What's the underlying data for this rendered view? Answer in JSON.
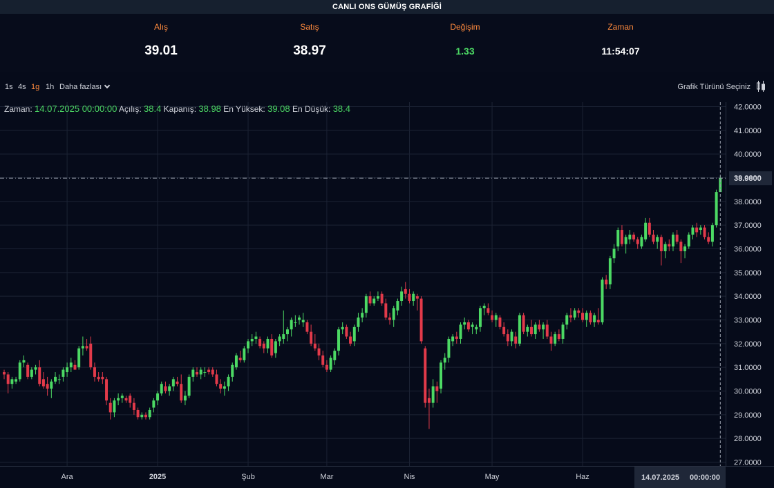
{
  "title": "CANLI ONS GÜMÜŞ GRAFİĞİ",
  "stats": {
    "alis_label": "Alış",
    "alis_value": "39.01",
    "satis_label": "Satış",
    "satis_value": "38.97",
    "degisim_label": "Değişim",
    "degisim_value": "1.33",
    "zaman_label": "Zaman",
    "zaman_value": "11:54:07"
  },
  "toolbar": {
    "timeframes": [
      "1s",
      "4s",
      "1g",
      "1h"
    ],
    "active_timeframe": "1g",
    "more_label": "Daha fazlası",
    "chart_type_label": "Grafik Türünü Seçiniz"
  },
  "ohlc": {
    "time_label": "Zaman:",
    "time_value": "14.07.2025 00:00:00",
    "open_label": "Açılış:",
    "open_value": "38.4",
    "close_label": "Kapanış:",
    "close_value": "38.98",
    "high_label": "En Yüksek:",
    "high_value": "39.08",
    "low_label": "En Düşük:",
    "low_value": "38.4"
  },
  "crosshair": {
    "date_label": "14.07.2025",
    "time_label": "00:00:00",
    "price_label": "38.9800"
  },
  "colors": {
    "up": "#4cd964",
    "down": "#e23a4a",
    "accent": "#ff8a3d",
    "background": "#060b1a",
    "grid": "#1c2334"
  },
  "chart_data": {
    "type": "candlestick",
    "ylim": [
      27,
      42
    ],
    "y_ticks": [
      "42.0000",
      "41.0000",
      "40.0000",
      "39.0000",
      "38.0000",
      "37.0000",
      "36.0000",
      "35.0000",
      "34.0000",
      "33.0000",
      "32.0000",
      "31.0000",
      "30.0000",
      "29.0000",
      "28.0000",
      "27.0000"
    ],
    "x_ticks": [
      {
        "label": "Ara",
        "index": 16,
        "bold": false
      },
      {
        "label": "2025",
        "index": 39,
        "bold": true
      },
      {
        "label": "Şub",
        "index": 62,
        "bold": false
      },
      {
        "label": "Mar",
        "index": 82,
        "bold": false
      },
      {
        "label": "Nis",
        "index": 103,
        "bold": false
      },
      {
        "label": "May",
        "index": 124,
        "bold": false
      },
      {
        "label": "Haz",
        "index": 147,
        "bold": false
      }
    ],
    "candles": [
      [
        30.8,
        30.9,
        30.5,
        30.7
      ],
      [
        30.7,
        30.8,
        29.9,
        30.3
      ],
      [
        30.3,
        30.6,
        30.1,
        30.5
      ],
      [
        30.4,
        30.6,
        30.3,
        30.5
      ],
      [
        30.5,
        31.3,
        30.4,
        31.2
      ],
      [
        31.2,
        31.5,
        31.0,
        31.3
      ],
      [
        31.1,
        31.2,
        30.5,
        30.6
      ],
      [
        30.6,
        31.0,
        30.5,
        30.9
      ],
      [
        30.9,
        31.1,
        30.7,
        31.0
      ],
      [
        31.0,
        31.3,
        30.2,
        30.3
      ],
      [
        30.5,
        30.8,
        30.1,
        30.2
      ],
      [
        30.3,
        30.6,
        29.8,
        30.1
      ],
      [
        30.1,
        30.5,
        29.7,
        30.4
      ],
      [
        30.4,
        30.8,
        30.3,
        30.6
      ],
      [
        30.5,
        30.7,
        30.3,
        30.5
      ],
      [
        30.6,
        31.0,
        30.4,
        30.9
      ],
      [
        30.8,
        31.2,
        30.6,
        31.0
      ],
      [
        31.0,
        31.4,
        30.8,
        31.2
      ],
      [
        31.1,
        31.3,
        30.9,
        30.9
      ],
      [
        31.0,
        31.9,
        30.9,
        31.8
      ],
      [
        31.8,
        32.3,
        31.5,
        31.9
      ],
      [
        31.9,
        32.2,
        31.7,
        31.8
      ],
      [
        32.0,
        32.3,
        30.9,
        31.0
      ],
      [
        31.0,
        31.2,
        30.4,
        30.6
      ],
      [
        30.6,
        30.8,
        30.4,
        30.5
      ],
      [
        30.6,
        30.8,
        30.3,
        30.5
      ],
      [
        30.5,
        30.6,
        29.4,
        29.6
      ],
      [
        29.5,
        29.7,
        28.8,
        29.1
      ],
      [
        29.1,
        29.7,
        28.9,
        29.6
      ],
      [
        29.6,
        29.9,
        29.4,
        29.7
      ],
      [
        29.7,
        29.9,
        29.5,
        29.8
      ],
      [
        29.7,
        29.8,
        29.5,
        29.6
      ],
      [
        29.8,
        29.9,
        29.3,
        29.5
      ],
      [
        29.5,
        29.7,
        29.0,
        29.2
      ],
      [
        29.2,
        29.3,
        28.8,
        28.9
      ],
      [
        28.9,
        29.1,
        28.8,
        29.0
      ],
      [
        29.0,
        29.1,
        28.8,
        28.9
      ],
      [
        28.9,
        29.3,
        28.8,
        29.2
      ],
      [
        29.3,
        29.7,
        29.1,
        29.6
      ],
      [
        29.6,
        30.0,
        29.4,
        29.9
      ],
      [
        29.9,
        30.4,
        29.8,
        30.3
      ],
      [
        30.2,
        30.4,
        29.9,
        30.0
      ],
      [
        30.0,
        30.3,
        29.8,
        30.2
      ],
      [
        30.2,
        30.6,
        30.0,
        30.5
      ],
      [
        30.4,
        30.6,
        30.2,
        30.3
      ],
      [
        30.3,
        30.7,
        29.5,
        29.6
      ],
      [
        29.6,
        30.0,
        29.4,
        29.8
      ],
      [
        29.8,
        30.7,
        29.7,
        30.6
      ],
      [
        30.6,
        31.0,
        30.4,
        30.9
      ],
      [
        30.8,
        31.0,
        30.6,
        30.7
      ],
      [
        30.7,
        31.0,
        30.5,
        30.9
      ],
      [
        30.8,
        31.0,
        30.6,
        30.8
      ],
      [
        30.9,
        31.0,
        30.7,
        30.8
      ],
      [
        30.9,
        31.0,
        30.6,
        30.7
      ],
      [
        30.7,
        30.9,
        30.2,
        30.3
      ],
      [
        30.3,
        30.5,
        29.9,
        30.1
      ],
      [
        30.1,
        30.4,
        29.8,
        30.2
      ],
      [
        30.2,
        30.7,
        30.0,
        30.6
      ],
      [
        30.6,
        31.2,
        30.4,
        31.1
      ],
      [
        31.0,
        31.6,
        30.9,
        31.5
      ],
      [
        31.4,
        31.7,
        31.2,
        31.3
      ],
      [
        31.3,
        31.9,
        31.2,
        31.8
      ],
      [
        31.8,
        32.2,
        31.6,
        32.1
      ],
      [
        32.1,
        32.4,
        31.9,
        32.2
      ],
      [
        32.2,
        32.5,
        32.0,
        32.3
      ],
      [
        32.2,
        32.3,
        31.8,
        31.9
      ],
      [
        32.0,
        32.1,
        31.6,
        31.8
      ],
      [
        31.8,
        32.3,
        31.6,
        32.2
      ],
      [
        32.2,
        32.4,
        31.4,
        31.5
      ],
      [
        31.6,
        32.2,
        31.4,
        32.1
      ],
      [
        32.1,
        32.4,
        31.9,
        32.3
      ],
      [
        32.2,
        33.4,
        32.0,
        32.4
      ],
      [
        32.4,
        32.7,
        32.1,
        32.6
      ],
      [
        32.6,
        33.1,
        32.3,
        33.0
      ],
      [
        32.9,
        33.2,
        32.7,
        32.9
      ],
      [
        33.0,
        33.2,
        32.8,
        33.1
      ],
      [
        32.9,
        33.3,
        32.7,
        33.0
      ],
      [
        32.9,
        33.0,
        32.4,
        32.5
      ],
      [
        32.5,
        32.8,
        31.9,
        32.0
      ],
      [
        32.0,
        32.4,
        31.7,
        31.8
      ],
      [
        31.8,
        32.0,
        31.3,
        31.5
      ],
      [
        31.5,
        31.7,
        31.0,
        31.1
      ],
      [
        31.1,
        31.3,
        30.8,
        30.9
      ],
      [
        30.9,
        31.5,
        30.8,
        31.4
      ],
      [
        31.3,
        31.8,
        31.1,
        31.7
      ],
      [
        31.7,
        32.7,
        31.5,
        32.6
      ],
      [
        32.6,
        32.9,
        32.4,
        32.7
      ],
      [
        32.7,
        32.8,
        32.2,
        32.3
      ],
      [
        32.3,
        32.5,
        31.9,
        32.0
      ],
      [
        32.1,
        32.8,
        31.9,
        32.7
      ],
      [
        32.7,
        33.3,
        32.5,
        33.1
      ],
      [
        33.1,
        33.5,
        32.9,
        33.3
      ],
      [
        33.3,
        34.1,
        33.1,
        34.0
      ],
      [
        34.0,
        34.2,
        33.6,
        33.7
      ],
      [
        33.7,
        34.0,
        33.6,
        33.9
      ],
      [
        33.9,
        34.2,
        33.8,
        34.0
      ],
      [
        34.1,
        34.2,
        33.6,
        33.7
      ],
      [
        33.7,
        33.9,
        33.0,
        33.1
      ],
      [
        33.1,
        33.3,
        32.8,
        33.0
      ],
      [
        33.0,
        33.6,
        32.7,
        33.5
      ],
      [
        33.4,
        33.9,
        33.2,
        33.8
      ],
      [
        33.8,
        34.4,
        33.6,
        34.2
      ],
      [
        34.3,
        34.6,
        33.9,
        34.1
      ],
      [
        34.1,
        34.3,
        33.7,
        33.8
      ],
      [
        33.8,
        34.2,
        33.6,
        34.1
      ],
      [
        34.0,
        34.1,
        33.4,
        33.9
      ],
      [
        33.9,
        34.0,
        32.0,
        32.1
      ],
      [
        31.8,
        31.9,
        29.3,
        29.5
      ],
      [
        29.7,
        30.1,
        28.4,
        29.5
      ],
      [
        29.5,
        30.5,
        29.3,
        30.2
      ],
      [
        30.2,
        30.4,
        29.5,
        30.0
      ],
      [
        30.1,
        31.3,
        29.9,
        31.2
      ],
      [
        31.2,
        31.6,
        30.9,
        31.4
      ],
      [
        31.4,
        32.3,
        31.2,
        32.2
      ],
      [
        32.1,
        32.4,
        31.9,
        32.3
      ],
      [
        32.3,
        32.5,
        32.0,
        32.2
      ],
      [
        32.2,
        32.9,
        32.0,
        32.8
      ],
      [
        32.8,
        33.1,
        32.6,
        32.9
      ],
      [
        32.9,
        33.0,
        32.5,
        32.6
      ],
      [
        32.7,
        32.9,
        32.4,
        32.8
      ],
      [
        32.6,
        32.8,
        32.4,
        32.7
      ],
      [
        32.7,
        33.6,
        32.5,
        33.5
      ],
      [
        33.5,
        33.7,
        33.2,
        33.6
      ],
      [
        33.5,
        33.7,
        33.2,
        33.3
      ],
      [
        33.2,
        33.4,
        32.9,
        33.0
      ],
      [
        33.0,
        33.3,
        32.7,
        33.2
      ],
      [
        33.1,
        33.2,
        32.6,
        32.7
      ],
      [
        32.7,
        32.9,
        32.3,
        32.4
      ],
      [
        32.4,
        32.6,
        31.9,
        32.1
      ],
      [
        32.1,
        32.6,
        31.9,
        32.5
      ],
      [
        32.3,
        32.5,
        31.8,
        32.0
      ],
      [
        32.0,
        33.3,
        31.9,
        33.2
      ],
      [
        33.2,
        33.3,
        32.4,
        32.5
      ],
      [
        32.5,
        32.8,
        32.3,
        32.7
      ],
      [
        32.7,
        33.0,
        32.3,
        32.4
      ],
      [
        32.4,
        32.9,
        32.2,
        32.8
      ],
      [
        32.8,
        33.0,
        32.5,
        32.6
      ],
      [
        32.6,
        32.9,
        32.2,
        32.8
      ],
      [
        32.8,
        33.0,
        32.2,
        32.3
      ],
      [
        32.3,
        32.5,
        31.7,
        32.0
      ],
      [
        32.0,
        32.5,
        31.9,
        32.4
      ],
      [
        32.4,
        32.6,
        32.1,
        32.2
      ],
      [
        32.2,
        32.9,
        32.0,
        32.8
      ],
      [
        32.8,
        33.3,
        32.6,
        33.2
      ],
      [
        33.2,
        33.5,
        32.9,
        33.1
      ],
      [
        33.1,
        33.5,
        33.0,
        33.4
      ],
      [
        33.4,
        33.5,
        33.1,
        33.3
      ],
      [
        33.3,
        33.5,
        32.9,
        33.0
      ],
      [
        33.0,
        33.4,
        32.7,
        33.3
      ],
      [
        33.3,
        33.4,
        32.8,
        32.9
      ],
      [
        32.9,
        33.3,
        32.7,
        33.2
      ],
      [
        33.0,
        33.5,
        32.8,
        32.9
      ],
      [
        32.9,
        34.8,
        32.8,
        34.7
      ],
      [
        34.7,
        34.9,
        34.3,
        34.5
      ],
      [
        34.5,
        35.7,
        34.3,
        35.6
      ],
      [
        35.6,
        36.2,
        35.4,
        36.0
      ],
      [
        36.1,
        36.9,
        35.9,
        36.8
      ],
      [
        36.8,
        37.0,
        36.1,
        36.2
      ],
      [
        36.2,
        36.6,
        35.8,
        36.5
      ],
      [
        36.4,
        36.8,
        36.2,
        36.6
      ],
      [
        36.6,
        36.7,
        36.3,
        36.4
      ],
      [
        36.4,
        36.5,
        36.0,
        36.2
      ],
      [
        36.1,
        36.6,
        36.0,
        36.5
      ],
      [
        36.4,
        37.3,
        36.3,
        37.1
      ],
      [
        37.1,
        37.3,
        36.5,
        36.6
      ],
      [
        36.6,
        36.8,
        36.2,
        36.3
      ],
      [
        36.3,
        36.6,
        36.0,
        36.5
      ],
      [
        36.5,
        36.6,
        35.3,
        35.9
      ],
      [
        35.9,
        36.3,
        35.6,
        36.2
      ],
      [
        36.2,
        36.4,
        35.9,
        36.1
      ],
      [
        36.1,
        36.7,
        35.9,
        36.6
      ],
      [
        36.6,
        36.8,
        36.2,
        36.3
      ],
      [
        36.3,
        36.4,
        35.4,
        35.9
      ],
      [
        35.9,
        36.2,
        35.6,
        36.1
      ],
      [
        36.1,
        36.7,
        36.0,
        36.6
      ],
      [
        36.6,
        37.0,
        36.4,
        36.9
      ],
      [
        36.9,
        37.1,
        36.5,
        36.7
      ],
      [
        36.8,
        37.0,
        36.6,
        36.9
      ],
      [
        36.9,
        37.0,
        36.4,
        36.5
      ],
      [
        36.5,
        36.7,
        36.2,
        36.3
      ],
      [
        36.3,
        37.1,
        36.1,
        37.0
      ],
      [
        37.0,
        38.5,
        36.9,
        38.4
      ],
      [
        38.4,
        39.08,
        38.4,
        38.98
      ]
    ]
  }
}
